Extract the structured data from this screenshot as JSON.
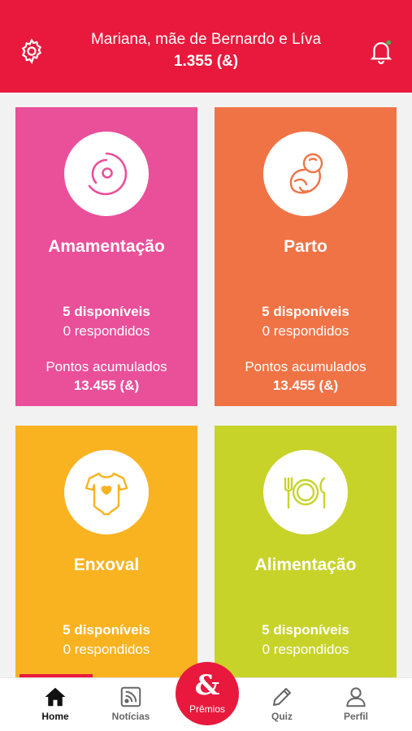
{
  "header": {
    "title": "Mariana, mãe de Bernardo e Líva",
    "points": "1.355 (&)",
    "settings_icon": "gear-icon",
    "notification_icon": "bell-icon",
    "background_color": "#e8193c"
  },
  "cards": [
    {
      "name": "Amamentação",
      "icon": "breastfeeding-icon",
      "available": "5 disponíveis",
      "answered": "0 respondidos",
      "accumulated_label": "Pontos acumulados",
      "accumulated_value": "13.455 (&)",
      "color": "#ea4f9a"
    },
    {
      "name": "Parto",
      "icon": "fetus-icon",
      "available": "5 disponíveis",
      "answered": "0 respondidos",
      "accumulated_label": "Pontos acumulados",
      "accumulated_value": "13.455 (&)",
      "color": "#f07346"
    },
    {
      "name": "Enxoval",
      "icon": "baby-bodysuit-icon",
      "available": "5 disponíveis",
      "answered": "0 respondidos",
      "color": "#f9b321"
    },
    {
      "name": "Alimentação",
      "icon": "plate-cutlery-icon",
      "available": "5 disponíveis",
      "answered": "0 respondidos",
      "color": "#c8d32a"
    }
  ],
  "bottom_nav": {
    "items": [
      {
        "label": "Home",
        "icon": "home-icon",
        "active": true
      },
      {
        "label": "Notícias",
        "icon": "news-icon",
        "active": false
      },
      {
        "label": "Prêmios",
        "icon": "ampersand-icon",
        "active": false
      },
      {
        "label": "Quiz",
        "icon": "pencil-icon",
        "active": false
      },
      {
        "label": "Perfil",
        "icon": "user-icon",
        "active": false
      }
    ],
    "fab_symbol": "&"
  }
}
